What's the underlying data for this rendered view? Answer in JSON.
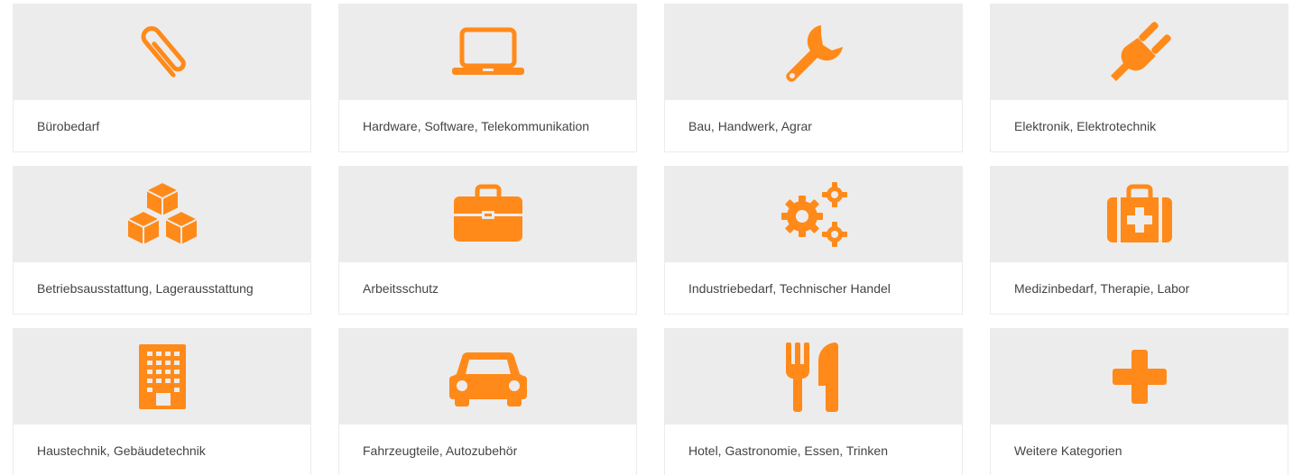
{
  "accent_color": "#ff8a1a",
  "categories": [
    {
      "label": "Bürobedarf",
      "icon": "paperclip-icon"
    },
    {
      "label": "Hardware, Software, Telekommunikation",
      "icon": "laptop-icon"
    },
    {
      "label": "Bau, Handwerk, Agrar",
      "icon": "wrench-icon"
    },
    {
      "label": "Elektronik, Elektrotechnik",
      "icon": "plug-icon"
    },
    {
      "label": "Betriebsausstattung, Lagerausstattung",
      "icon": "cubes-icon"
    },
    {
      "label": "Arbeitsschutz",
      "icon": "toolbox-icon"
    },
    {
      "label": "Industriebedarf, Technischer Handel",
      "icon": "gears-icon"
    },
    {
      "label": "Medizinbedarf, Therapie, Labor",
      "icon": "medkit-icon"
    },
    {
      "label": "Haustechnik, Gebäudetechnik",
      "icon": "building-icon"
    },
    {
      "label": "Fahrzeugteile, Autozubehör",
      "icon": "car-icon"
    },
    {
      "label": "Hotel, Gastronomie, Essen, Trinken",
      "icon": "cutlery-icon"
    },
    {
      "label": "Weitere Kategorien",
      "icon": "plus-icon"
    }
  ]
}
